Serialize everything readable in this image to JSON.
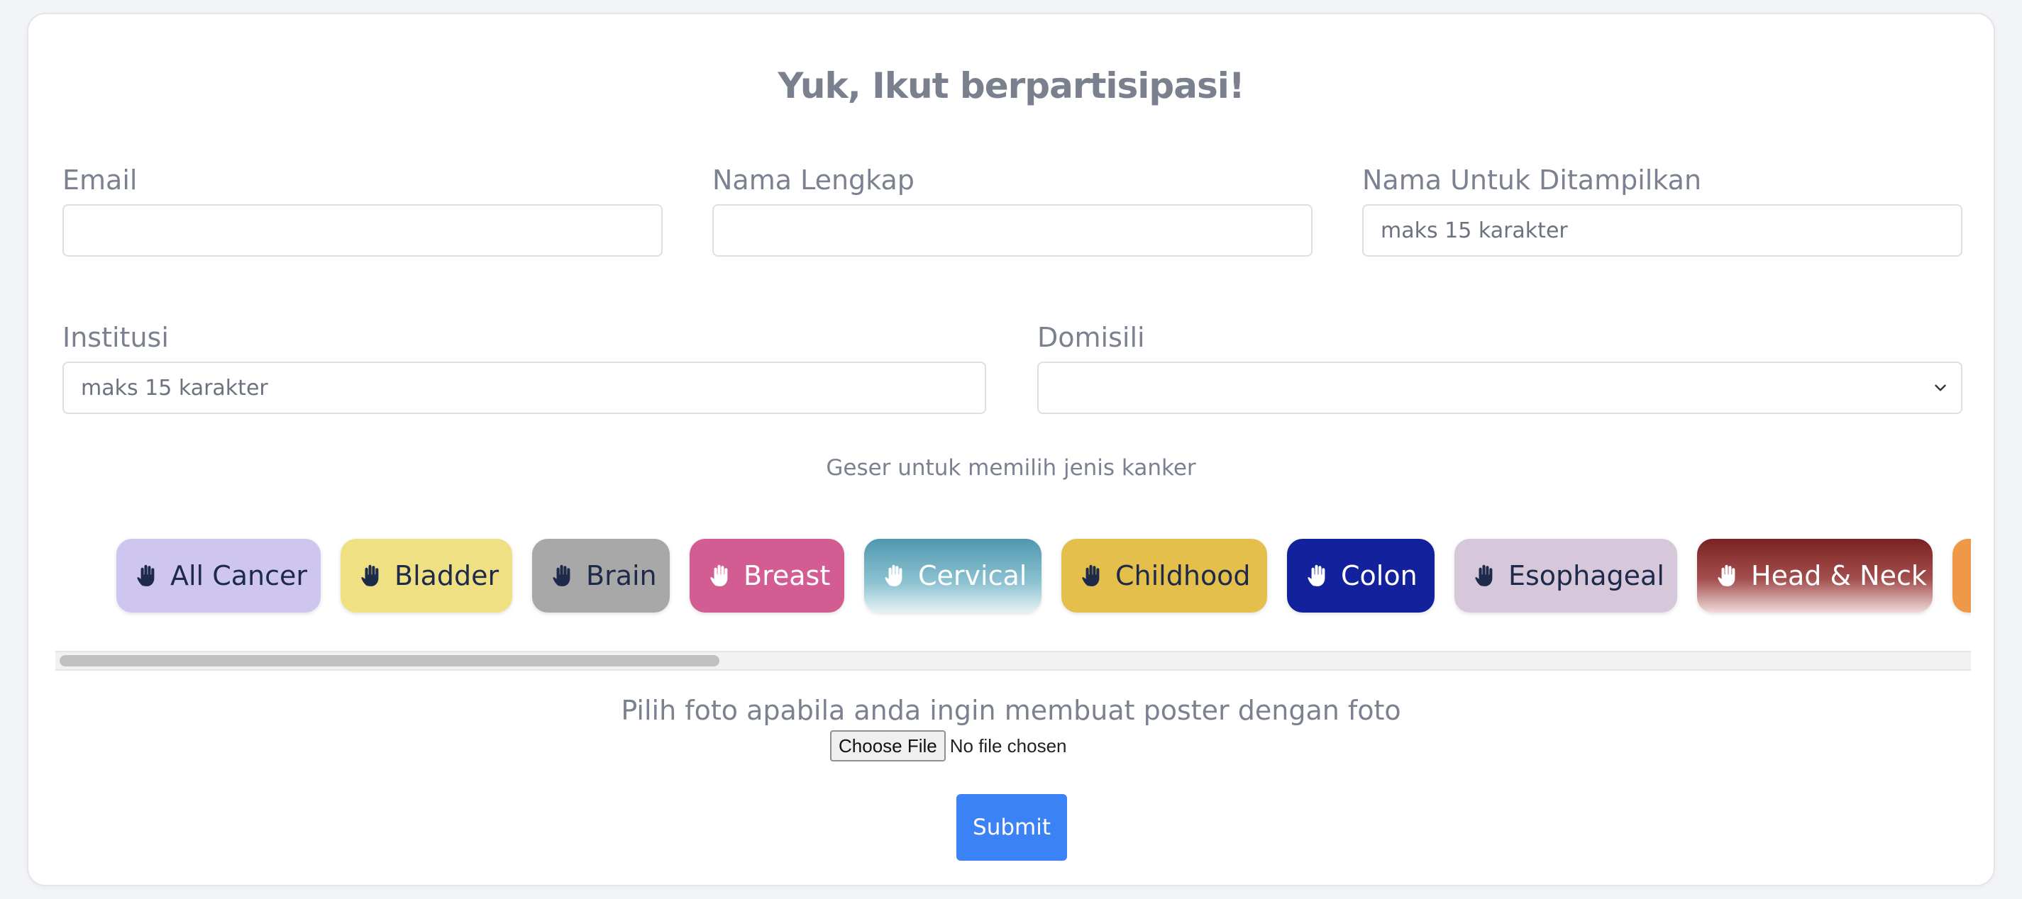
{
  "form": {
    "title": "Yuk, Ikut berpartisipasi!",
    "email_label": "Email",
    "email_value": "",
    "fullname_label": "Nama Lengkap",
    "fullname_value": "",
    "display_label": "Nama Untuk Ditampilkan",
    "display_placeholder": "maks 15 karakter",
    "institution_label": "Institusi",
    "institution_placeholder": "maks 15 karakter",
    "domicile_label": "Domisili",
    "domicile_value": ""
  },
  "cancer_hint": "Geser untuk memilih jenis kanker",
  "cancer_types": [
    {
      "name": "All Cancer",
      "bg": "#cfc6f0",
      "fg": "#1e2a4a",
      "icon": "hand-icon"
    },
    {
      "name": "Bladder",
      "bg": "#f0e084",
      "fg": "#1e2a4a",
      "icon": "hand-icon"
    },
    {
      "name": "Brain",
      "bg": "#a8a8a8",
      "fg": "#1e2a4a",
      "icon": "hand-icon"
    },
    {
      "name": "Breast",
      "bg": "#d35d92",
      "fg": "#ffffff",
      "icon": "hand-icon"
    },
    {
      "name": "Cervical",
      "bg": "#5aa2b8",
      "fg": "#ffffff",
      "icon": "hand-icon"
    },
    {
      "name": "Childhood",
      "bg": "#e4bf4b",
      "fg": "#1e2a4a",
      "icon": "hand-icon"
    },
    {
      "name": "Colon",
      "bg": "#13229c",
      "fg": "#ffffff",
      "icon": "hand-icon"
    },
    {
      "name": "Esophageal",
      "bg": "#d6c7da",
      "fg": "#1e2a4a",
      "icon": "hand-icon"
    },
    {
      "name": "Head & Neck",
      "bg": "#7f2a2a",
      "fg": "#ffffff",
      "icon": "hand-icon"
    },
    {
      "name": "",
      "bg": "#ee9848",
      "fg": "#1e2a4a",
      "icon": "hand-icon"
    }
  ],
  "photo": {
    "hint": "Pilih foto apabila anda ingin membuat poster dengan foto",
    "button": "Choose File",
    "status": "No file chosen"
  },
  "submit_label": "Submit"
}
